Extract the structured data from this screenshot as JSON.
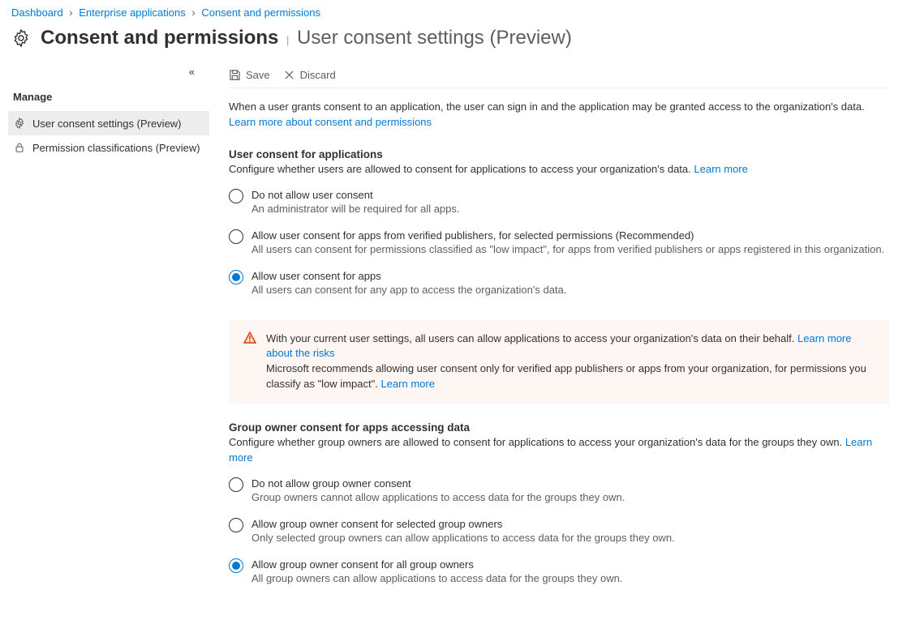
{
  "breadcrumb": {
    "items": [
      "Dashboard",
      "Enterprise applications",
      "Consent and permissions"
    ]
  },
  "header": {
    "title": "Consent and permissions",
    "subtitle": "User consent settings (Preview)"
  },
  "sidebar": {
    "heading": "Manage",
    "items": [
      {
        "label": "User consent settings (Preview)",
        "active": true
      },
      {
        "label": "Permission classifications (Preview)",
        "active": false
      }
    ]
  },
  "toolbar": {
    "save": "Save",
    "discard": "Discard"
  },
  "intro": {
    "text": "When a user grants consent to an application, the user can sign in and the application may be granted access to the organization's data.",
    "link": "Learn more about consent and permissions"
  },
  "section1": {
    "title": "User consent for applications",
    "desc": "Configure whether users are allowed to consent for applications to access your organization's data.",
    "learn_more": "Learn more",
    "options": [
      {
        "label": "Do not allow user consent",
        "desc": "An administrator will be required for all apps."
      },
      {
        "label": "Allow user consent for apps from verified publishers, for selected permissions (Recommended)",
        "desc": "All users can consent for permissions classified as \"low impact\", for apps from verified publishers or apps registered in this organization."
      },
      {
        "label": "Allow user consent for apps",
        "desc": "All users can consent for any app to access the organization's data."
      }
    ],
    "selected": 2
  },
  "warning": {
    "text1": "With your current user settings, all users can allow applications to access your organization's data on their behalf.",
    "link1": "Learn more about the risks",
    "text2": "Microsoft recommends allowing user consent only for verified app publishers or apps from your organization, for permissions you classify as \"low impact\".",
    "link2": "Learn more"
  },
  "section2": {
    "title": "Group owner consent for apps accessing data",
    "desc": "Configure whether group owners are allowed to consent for applications to access your organization's data for the groups they own.",
    "learn_more": "Learn more",
    "options": [
      {
        "label": "Do not allow group owner consent",
        "desc": "Group owners cannot allow applications to access data for the groups they own."
      },
      {
        "label": "Allow group owner consent for selected group owners",
        "desc": "Only selected group owners can allow applications to access data for the groups they own."
      },
      {
        "label": "Allow group owner consent for all group owners",
        "desc": "All group owners can allow applications to access data for the groups they own."
      }
    ],
    "selected": 2
  }
}
